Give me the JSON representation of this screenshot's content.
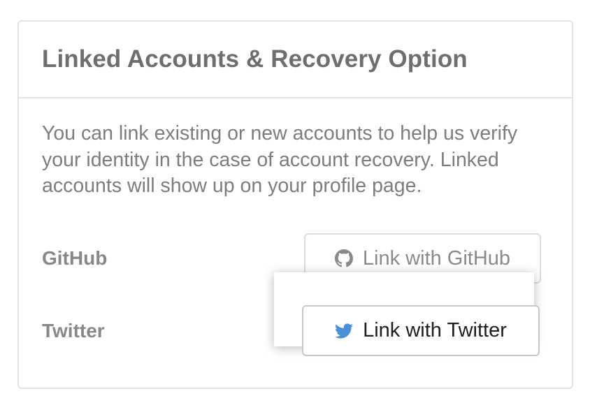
{
  "card": {
    "title": "Linked Accounts & Recovery Option",
    "description": "You can link existing or new accounts to help us verify your identity in the case of account recovery. Linked accounts will show up on your profile page."
  },
  "accounts": [
    {
      "label": "GitHub",
      "button_label": "Link with GitHub",
      "icon": "github-icon",
      "icon_color": "#8a8a8a"
    },
    {
      "label": "Twitter",
      "button_label": "Link with Twitter",
      "icon": "twitter-icon",
      "icon_color": "#4a90d9"
    }
  ],
  "colors": {
    "title": "#6e6e6e",
    "text": "#7d7d7d",
    "border": "#e4e4e4",
    "twitter_blue": "#4a90d9"
  }
}
